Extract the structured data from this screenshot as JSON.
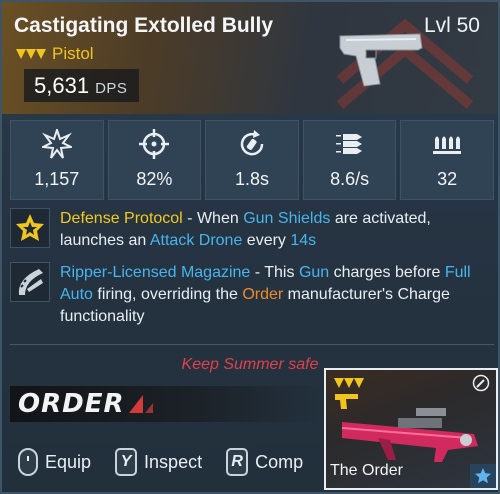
{
  "item": {
    "name": "Castigating Extolled Bully",
    "level": "Lvl 50",
    "type": "Pistol",
    "dps_value": "5,631",
    "dps_unit": "DPS",
    "rarity_color": "#f0c51e",
    "rarity_icon": "chevron-rarity-icon",
    "weapon_icon": "pistol-icon"
  },
  "stats": [
    {
      "icon": "damage-burst-icon",
      "value": "1,157"
    },
    {
      "icon": "crosshair-icon",
      "value": "82%"
    },
    {
      "icon": "reload-icon",
      "value": "1.8s"
    },
    {
      "icon": "fire-rate-icon",
      "value": "8.6/s"
    },
    {
      "icon": "magazine-icon",
      "value": "32"
    }
  ],
  "perks": [
    {
      "icon": "star-shield-icon",
      "name": "Defense Protocol",
      "t1": " - When ",
      "k1": "Gun Shields",
      "t2": " are activated, launches an ",
      "k2": "Attack Drone",
      "t3": " every ",
      "k3": "14s"
    },
    {
      "icon": "magazine-claw-icon",
      "name": "Ripper-Licensed Magazine",
      "t1": " - This ",
      "k1": "Gun",
      "t2": " charges before ",
      "k2": "Full Auto",
      "t3": " firing, overriding the ",
      "k3": "Order",
      "t4": " manufacturer's Charge functionality"
    }
  ],
  "flavor_text": "Keep Summer safe",
  "manufacturer": "ORDER",
  "actions": [
    {
      "key": "",
      "icon": "mouse-icon",
      "label": "Equip"
    },
    {
      "key": "Y",
      "label": "Inspect"
    },
    {
      "key": "R",
      "label": "Comp"
    }
  ],
  "compare_card": {
    "name": "The Order",
    "rarity_icon": "chevron-rarity-icon",
    "corner_icon": "wrench-icon",
    "weapon_icon": "heavy-rifle-icon",
    "favorite_icon": "star-icon",
    "accent_color": "#e6336a"
  }
}
